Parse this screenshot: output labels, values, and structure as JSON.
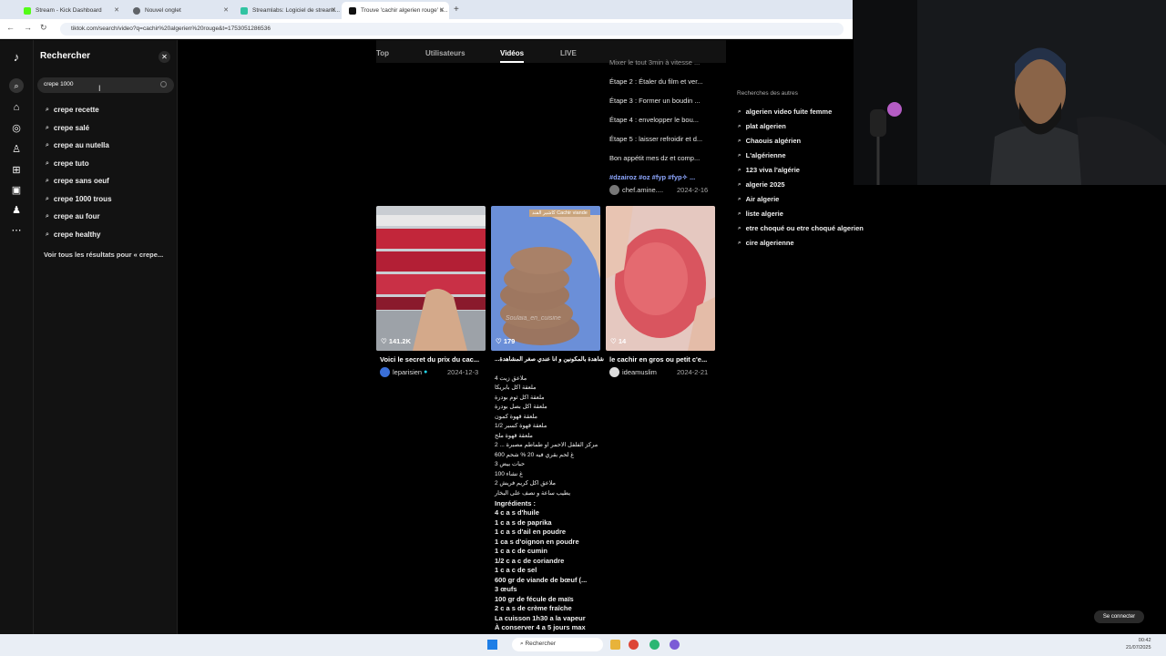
{
  "browser": {
    "tabs": [
      {
        "label": "Stream - Kick Dashboard",
        "color": "#53fc18"
      },
      {
        "label": "Nouvel onglet",
        "color": "#5f6368"
      },
      {
        "label": "Streamlabs: Logiciel de streami...",
        "color": "#31c3a2"
      },
      {
        "label": "Trouve 'cachir algerien rouge' s...",
        "color": "#111111"
      }
    ],
    "url": "tiktok.com/search/video?q=cachir%20algerien%20rouge&t=1753051286536"
  },
  "panel": {
    "title": "Rechercher",
    "search_value": "crepe 1000",
    "suggestions": [
      "crepe recette",
      "crepe salé",
      "crepe au nutella",
      "crepe tuto",
      "crepe sans oeuf",
      "crepe 1000 trous",
      "crepe au four",
      "crepe healthy"
    ],
    "see_all": "Voir tous les résultats pour « crepe..."
  },
  "results": {
    "tabs": [
      "Top",
      "Utilisateurs",
      "Vidéos",
      "LIVE"
    ],
    "active_tab": "Vidéos",
    "desc_lines": [
      "Mixer le tout 3min à vitesse ...",
      "Étape 2 : Étaler du film et ver...",
      "Étape 3 : Former un boudin ...",
      "Étape 4 : envelopper le bou...",
      "Étape 5 : laisser refroidir et d...",
      "Bon appétit mes dz et comp..."
    ],
    "hashtags": "#dzairoz #oz #fyp #fyp✧ ...",
    "top_author": "chef.amine....",
    "top_date": "2024-2-16",
    "videos": [
      {
        "likes": "141.2K",
        "caption": "Voici le secret du prix du cac...",
        "author": "leparisien",
        "date": "2024-12-3"
      },
      {
        "likes": "179",
        "caption": "شاهدة بالمكونين و انا عندي صغر المشاهدة...",
        "overlay": "كاشير الفند Cachir viande",
        "watermark": "Soulaia_en_cuisine"
      },
      {
        "likes": "14",
        "caption": "le cachir en gros ou petit c'e...",
        "author": "ideamuslim",
        "date": "2024-2-21"
      }
    ],
    "recipe_lines": [
      "4 ملاعق زيت",
      "ملعقة اكل بابريكا",
      "ملعقة اكل ثوم بودرة",
      "ملعقة اكل بصل بودرة",
      "ملعقة قهوة كمون",
      "1/2 ملعقة قهوة كسبر",
      "ملعقة قهوة ملح",
      "2 ... مركز الفلفل الاحمر او طماطم مصبرة",
      "600 غ لحم بقري فيه 20 % شحم",
      "3 حبات بيض",
      "100 غ نشاء",
      "2 ملاعق اكل كريم فريش",
      "يطيب ساعة و نصف على البخار",
      "Ingrédients :",
      "4 c a s d'huile",
      "1 c a s de paprika",
      "1 c a s d'ail en poudre",
      "1 ca s d'oignon en poudre",
      "1 c a c de cumin",
      "1/2 c a c de coriandre",
      "1 c a c de sel",
      "600 gr de viande de bœuf (...",
      "3 œufs",
      "100 gr de fécule de maïs",
      "2 c a s de crème fraîche",
      "La cuisson 1h30 a la vapeur",
      "À conserver 4 a 5 jours max"
    ]
  },
  "others": {
    "title": "Recherches des autres",
    "items": [
      "algerien video fuite femme",
      "plat algerien",
      "Chaouis algérien",
      "L'algérienne",
      "123 viva l'algérie",
      "algerie 2025",
      "Air algerie",
      "liste algerie",
      "etre choqué ou etre choqué algerien",
      "cire algerienne"
    ]
  },
  "login_button": "Se connecter",
  "taskbar": {
    "search": "Rechercher",
    "time": "00:42",
    "date": "21/07/2025"
  }
}
